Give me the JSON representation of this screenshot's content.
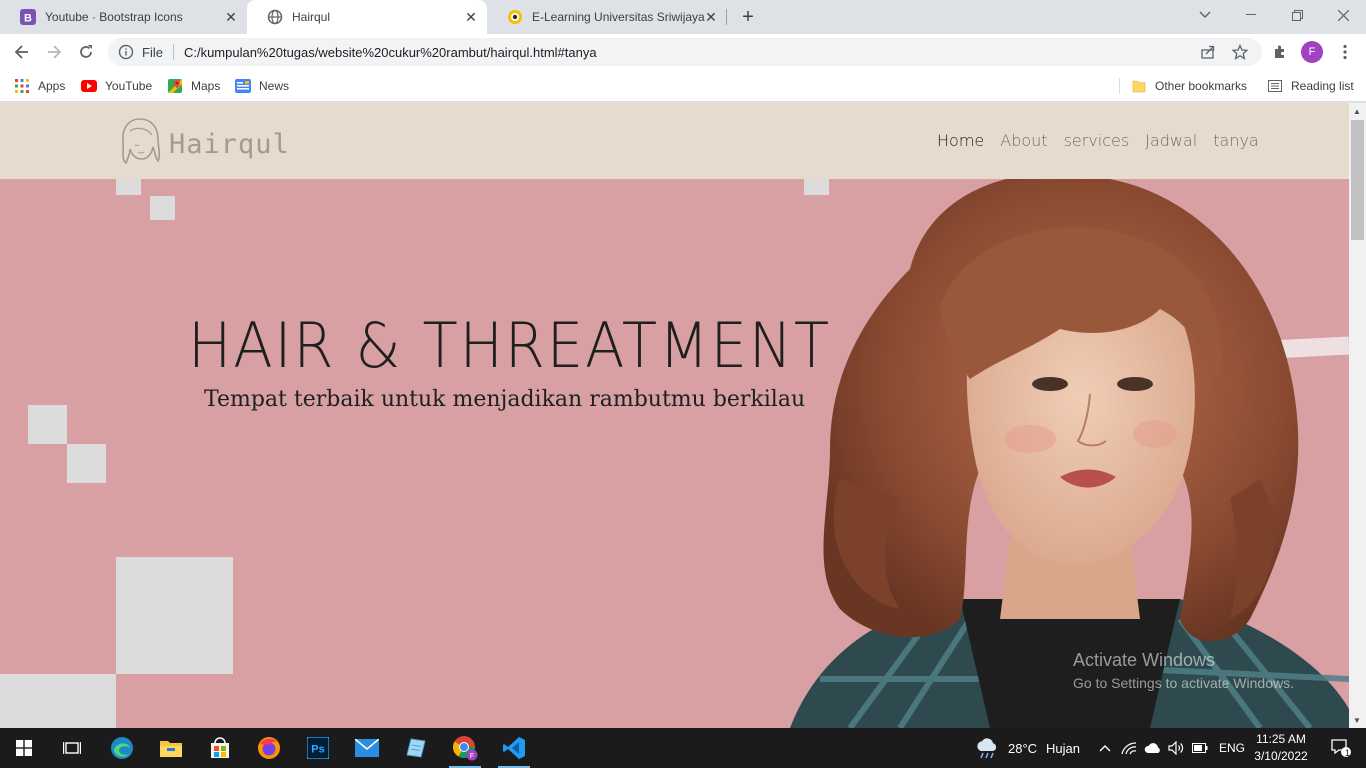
{
  "browser": {
    "tabs": [
      {
        "title": "Youtube · Bootstrap Icons",
        "icon": "bootstrap-favicon",
        "active": false
      },
      {
        "title": "Hairqul",
        "icon": "globe-icon",
        "active": true
      },
      {
        "title": "E-Learning Universitas Sriwijaya",
        "icon": "elearning-favicon",
        "active": false
      }
    ],
    "address": {
      "scheme_label": "File",
      "url": "C:/kumpulan%20tugas/website%20cukur%20rambut/hairqul.html#tanya"
    },
    "profile_initial": "F",
    "bookmarks": [
      {
        "label": "Apps",
        "icon": "apps-grid-icon"
      },
      {
        "label": "YouTube",
        "icon": "youtube-icon"
      },
      {
        "label": "Maps",
        "icon": "maps-icon"
      },
      {
        "label": "News",
        "icon": "news-icon"
      }
    ],
    "other_bookmarks": "Other bookmarks",
    "reading_list": "Reading list"
  },
  "site": {
    "logo_text": "Hairqul",
    "nav": [
      {
        "label": "Home",
        "active": true
      },
      {
        "label": "About",
        "active": false
      },
      {
        "label": "services",
        "active": false
      },
      {
        "label": "Jadwal",
        "active": false
      },
      {
        "label": "tanya",
        "active": false
      }
    ],
    "hero_title": "HAIR & THREATMENT",
    "hero_subtitle": "Tempat terbaik untuk menjadikan rambutmu berkilau",
    "colors": {
      "nav_bg": "#e6dccd",
      "hero_bg": "#d8a0a2",
      "squares": "#dcdcdc"
    }
  },
  "watermark": {
    "line1": "Activate Windows",
    "line2": "Go to Settings to activate Windows."
  },
  "taskbar": {
    "weather": "28°C",
    "weather_desc": "Hujan",
    "lang": "ENG",
    "time": "11:25 AM",
    "date": "3/10/2022",
    "notification_count": "1"
  }
}
